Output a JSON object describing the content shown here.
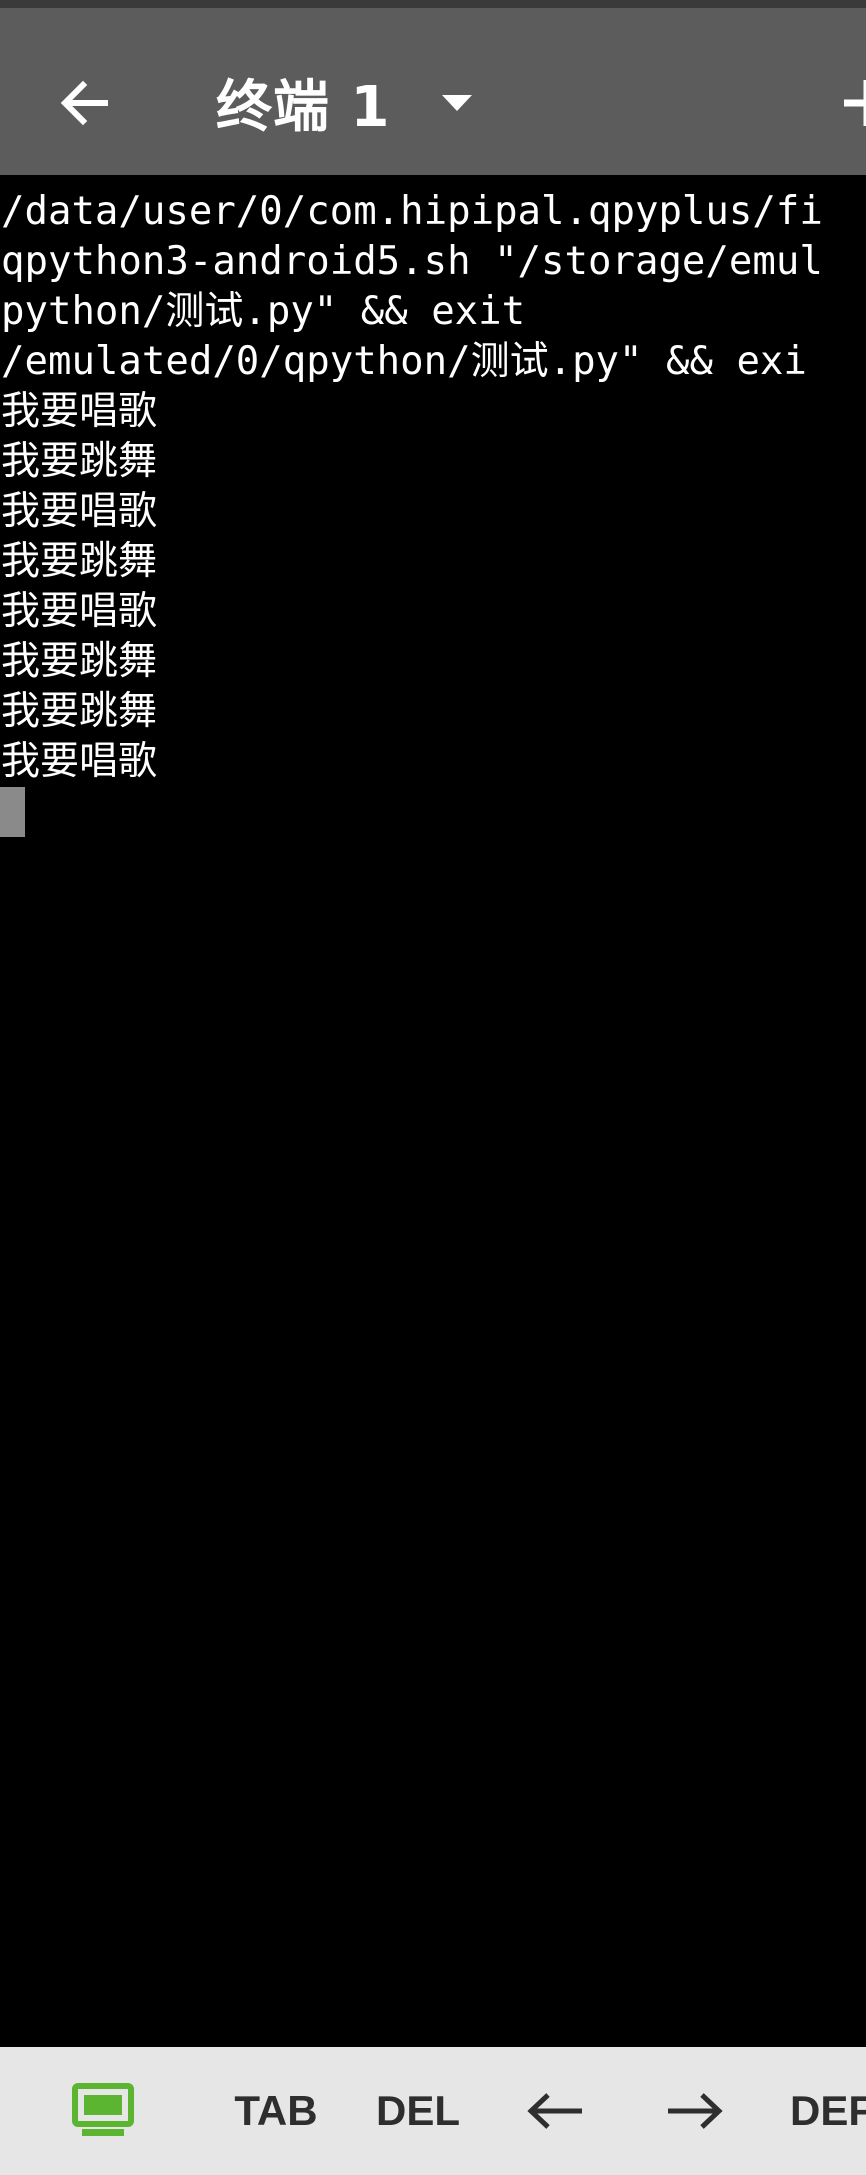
{
  "app_bar": {
    "session_title": "终端 1",
    "back_icon": "arrow-left-icon",
    "dropdown_icon": "caret-down-icon",
    "add_icon": "plus-icon",
    "background": "#5c5c5c"
  },
  "terminal": {
    "lines": [
      "/data/user/0/com.hipipal.qpyplus/fi",
      "qpython3-android5.sh \"/storage/emul",
      "python/测试.py\" && exit",
      "/emulated/0/qpython/测试.py\" && exi",
      "我要唱歌",
      "我要跳舞",
      "我要唱歌",
      "我要跳舞",
      "我要唱歌",
      "我要跳舞",
      "我要跳舞",
      "我要唱歌"
    ],
    "background": "#000000",
    "foreground": "#ffffff",
    "cursor_color": "#8a8a8a"
  },
  "extra_keys": {
    "keyboard_icon": "keyboard-toggle-icon",
    "keyboard_icon_color": "#5cb531",
    "tab": "TAB",
    "del": "DEL",
    "left": "←",
    "right": "→",
    "def": "DEF"
  }
}
